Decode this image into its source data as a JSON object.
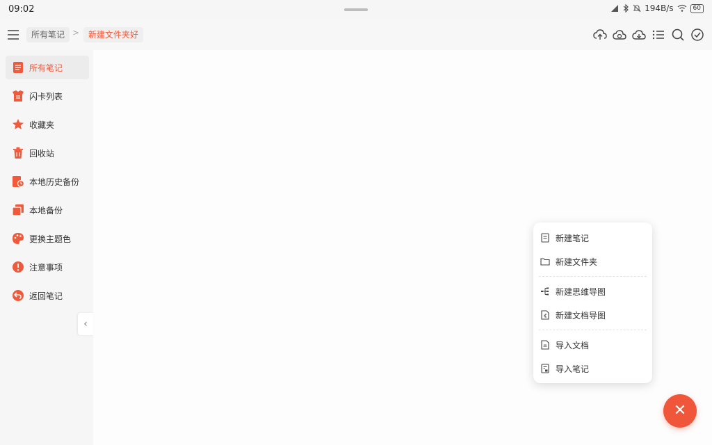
{
  "status_bar": {
    "time": "09:02",
    "net_speed": "194B/s",
    "battery": "60"
  },
  "toolbar": {
    "breadcrumb": [
      "所有笔记",
      "新建文件夹好"
    ],
    "separator": ">",
    "icons": [
      "cloud-upload-icon",
      "cloud-sync-icon",
      "cloud-download-icon",
      "list-icon",
      "search-icon",
      "check-circle-icon"
    ]
  },
  "sidebar": {
    "items": [
      {
        "label": "所有笔记",
        "icon": "note-icon",
        "active": true
      },
      {
        "label": "闪卡列表",
        "icon": "flashcard-icon",
        "active": false
      },
      {
        "label": "收藏夹",
        "icon": "star-icon",
        "active": false
      },
      {
        "label": "回收站",
        "icon": "trash-icon",
        "active": false
      },
      {
        "label": "本地历史备份",
        "icon": "history-backup-icon",
        "active": false
      },
      {
        "label": "本地备份",
        "icon": "backup-icon",
        "active": false
      },
      {
        "label": "更换主题色",
        "icon": "palette-icon",
        "active": false
      },
      {
        "label": "注意事项",
        "icon": "warning-icon",
        "active": false
      },
      {
        "label": "返回笔记",
        "icon": "back-icon",
        "active": false
      }
    ],
    "collapse_glyph": "‹"
  },
  "popup_menu": {
    "items": [
      {
        "label": "新建笔记",
        "icon": "new-note-icon"
      },
      {
        "label": "新建文件夹",
        "icon": "folder-icon"
      },
      {
        "label": "新建思维导图",
        "icon": "mindmap-icon"
      },
      {
        "label": "新建文档导图",
        "icon": "doc-mindmap-icon"
      },
      {
        "label": "导入文档",
        "icon": "import-doc-icon"
      },
      {
        "label": "导入笔记",
        "icon": "import-note-icon"
      }
    ]
  },
  "fab": {
    "glyph": "✕"
  },
  "colors": {
    "accent": "#ef5a3c",
    "fab": "#f0563a"
  }
}
